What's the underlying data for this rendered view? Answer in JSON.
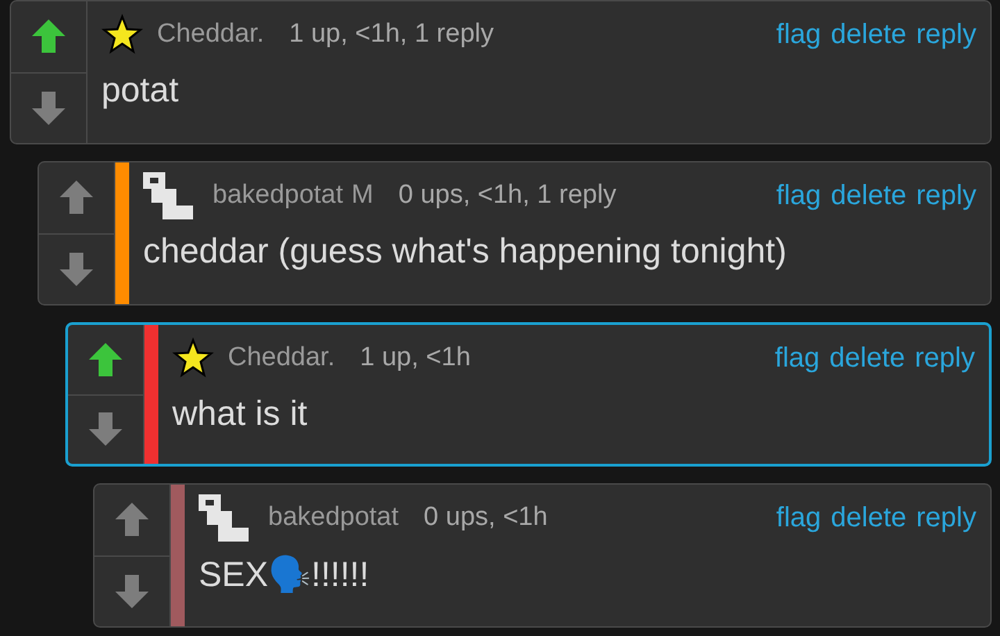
{
  "comments": [
    {
      "upvoted": true,
      "badge": {
        "kind": "star"
      },
      "author": "Cheddar.",
      "meta": "1 up, <1h, 1 reply",
      "actions": [
        "flag",
        "delete",
        "reply"
      ],
      "body": "potat",
      "highlighted": false,
      "children": [
        {
          "upvoted": false,
          "badge": {
            "kind": "blocks"
          },
          "author": "bakedpotat",
          "mod": "M",
          "meta": "0 ups, <1h, 1 reply",
          "actions": [
            "flag",
            "delete",
            "reply"
          ],
          "body": "cheddar (guess what's happening tonight)",
          "color": "#ff8c00",
          "highlighted": false,
          "children": [
            {
              "upvoted": true,
              "badge": {
                "kind": "star"
              },
              "author": "Cheddar.",
              "meta": "1 up, <1h",
              "actions": [
                "flag",
                "delete",
                "reply"
              ],
              "body": "what is it",
              "color": "#f03030",
              "highlighted": true,
              "children": [
                {
                  "upvoted": false,
                  "badge": {
                    "kind": "blocks"
                  },
                  "author": "bakedpotat",
                  "meta": "0 ups, <1h",
                  "actions": [
                    "flag",
                    "delete",
                    "reply"
                  ],
                  "body": "SEX🗣️!!!!!!",
                  "color": "#a05a5e",
                  "highlighted": false
                }
              ]
            }
          ]
        }
      ]
    }
  ]
}
